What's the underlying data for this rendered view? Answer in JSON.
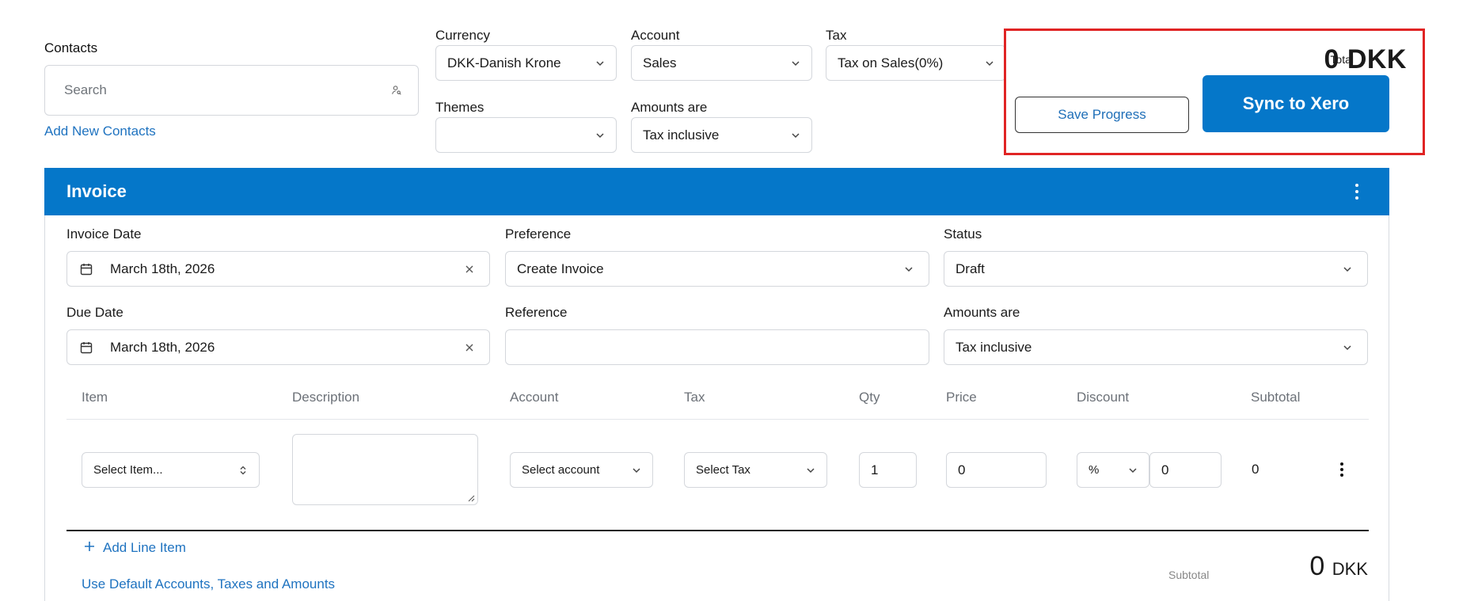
{
  "contacts": {
    "label": "Contacts",
    "search_placeholder": "Search",
    "add_link": "Add New Contacts"
  },
  "top_filters": {
    "currency": {
      "label": "Currency",
      "value": "DKK-Danish Krone"
    },
    "account": {
      "label": "Account",
      "value": "Sales"
    },
    "tax": {
      "label": "Tax",
      "value": "Tax on Sales(0%)"
    },
    "themes": {
      "label": "Themes",
      "value": ""
    },
    "amounts_are": {
      "label": "Amounts are",
      "value": "Tax inclusive"
    }
  },
  "summary": {
    "total_label": "Total",
    "total_value": "0 DKK",
    "save_label": "Save Progress",
    "sync_label": "Sync to Xero",
    "highlight_color": "#e02424",
    "accent_color": "#0577c9"
  },
  "invoice": {
    "title": "Invoice",
    "invoice_date": {
      "label": "Invoice Date",
      "value": "March 18th, 2026"
    },
    "preference": {
      "label": "Preference",
      "value": "Create Invoice"
    },
    "status": {
      "label": "Status",
      "value": "Draft"
    },
    "due_date": {
      "label": "Due Date",
      "value": "March 18th, 2026"
    },
    "reference": {
      "label": "Reference",
      "value": ""
    },
    "amounts_are": {
      "label": "Amounts are",
      "value": "Tax inclusive"
    },
    "columns": [
      "Item",
      "Description",
      "Account",
      "Tax",
      "Qty",
      "Price",
      "Discount",
      "Subtotal"
    ],
    "line": {
      "item_placeholder": "Select Item...",
      "description": "",
      "account_placeholder": "Select account",
      "tax_placeholder": "Select Tax",
      "qty": "1",
      "price": "0",
      "discount_type": "%",
      "discount_value": "0",
      "subtotal": "0"
    },
    "add_line_label": "Add Line Item",
    "default_link": "Use Default Accounts, Taxes and Amounts",
    "subtotal_label": "Subtotal",
    "subtotal_number": "0",
    "subtotal_currency": "DKK"
  }
}
